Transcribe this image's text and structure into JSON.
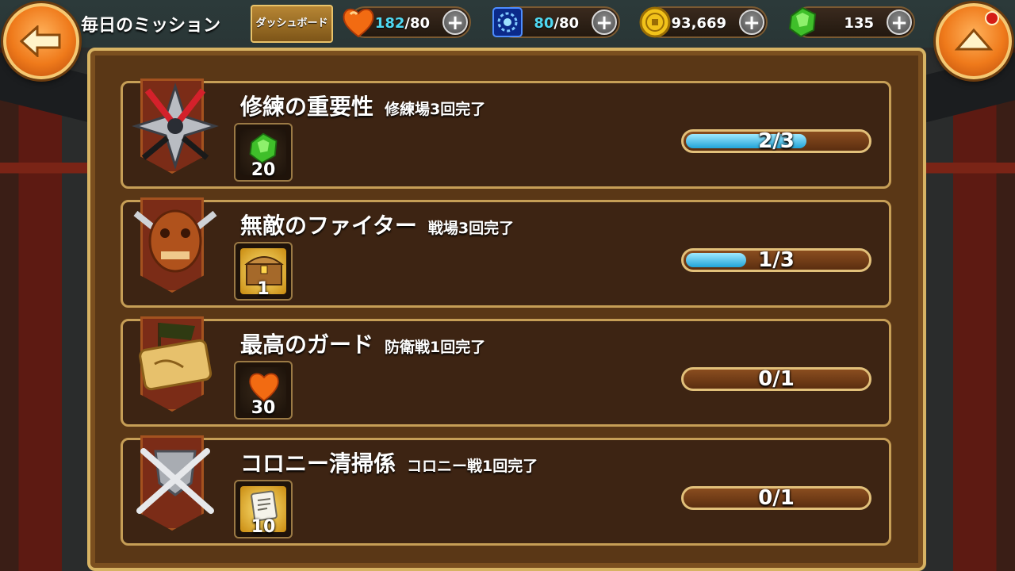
{
  "header": {
    "title": "毎日のミッション",
    "dashboard_label": "ダッシュボード"
  },
  "resources": [
    {
      "name": "stamina",
      "icon": "heart-icon",
      "current": "182",
      "max": "/80"
    },
    {
      "name": "energy",
      "icon": "blue-orb-icon",
      "current": "80",
      "max": "/80"
    },
    {
      "name": "gold",
      "icon": "gold-coin-icon",
      "current": "",
      "max": "93,669"
    },
    {
      "name": "gems",
      "icon": "green-gem-icon",
      "current": "",
      "max": "135"
    }
  ],
  "missions": [
    {
      "title": "修練の重要性",
      "condition": "修練場3回完了",
      "emblem": "shuriken-emblem-icon",
      "reward_icon": "green-gem-icon",
      "reward_count": "20",
      "progress_text": "2/3",
      "progress": 0.667
    },
    {
      "title": "無敵のファイター",
      "condition": "戦場3回完了",
      "emblem": "demon-mask-emblem-icon",
      "reward_icon": "treasure-chest-icon",
      "reward_count": "1",
      "progress_text": "1/3",
      "progress": 0.333
    },
    {
      "title": "最高のガード",
      "condition": "防衛戦1回完了",
      "emblem": "flag-scroll-emblem-icon",
      "reward_icon": "heart-icon",
      "reward_count": "30",
      "progress_text": "0/1",
      "progress": 0
    },
    {
      "title": "コロニー清掃係",
      "condition": "コロニー戦1回完了",
      "emblem": "crossed-swords-shield-emblem-icon",
      "reward_icon": "scroll-ticket-icon",
      "reward_count": "10",
      "progress_text": "0/1",
      "progress": 0
    }
  ],
  "colors": {
    "progress_fill": "#21a4d8",
    "current_value": "#4fd8f2",
    "frame_gold": "#d7b363"
  }
}
